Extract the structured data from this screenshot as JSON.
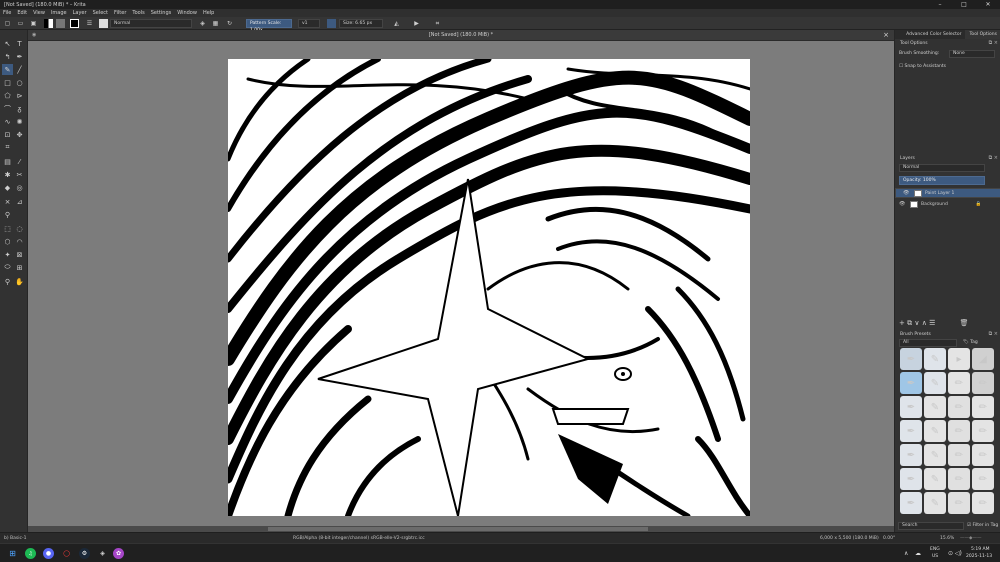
{
  "window": {
    "title": "[Not Saved] (180.0 MiB) * – Krita",
    "controls": [
      "–",
      "□",
      "✕"
    ]
  },
  "menu": [
    "File",
    "Edit",
    "View",
    "Image",
    "Layer",
    "Select",
    "Filter",
    "Tools",
    "Settings",
    "Window",
    "Help"
  ],
  "toolbar": {
    "blend_mode": "Normal",
    "pattern_scale": "Pattern Scale: 1.00x",
    "pattern_angle": "v1",
    "brush_size": "Size: 6.65 px",
    "colors": {
      "foreground": "#000000",
      "background": "#ffffff",
      "accent": "#3d5a80"
    }
  },
  "document": {
    "tab_title": "[Not Saved] (180.0 MiB) *"
  },
  "dock": {
    "tabs": [
      "Advanced Color Selector",
      "Tool Options"
    ],
    "tool_options": {
      "title": "Tool Options",
      "smoothing_label": "Brush Smoothing:",
      "smoothing_value": "None",
      "snap_label": "Snap to Assistants"
    },
    "layers": {
      "title": "Layers",
      "blend_mode": "Normal",
      "opacity": "Opacity: 100%",
      "items": [
        {
          "name": "Paint Layer 1",
          "selected": true
        },
        {
          "name": "Background",
          "selected": false
        }
      ]
    },
    "brush_presets": {
      "title": "Brush Presets",
      "filter": "All",
      "tag_label": "Tag",
      "search_placeholder": "Search",
      "filter_in_tag": "Filter in Tag"
    }
  },
  "status": {
    "brush": "b) Basic-1",
    "color_profile": "RGB/Alpha (8-bit integer/channel)  sRGB-elle-V2-srgbtrc.icc",
    "dimensions": "6,000 x 5,500 (180.0 MiB)",
    "rotation": "0.00°",
    "zoom": "15.6%"
  },
  "taskbar": {
    "lang_top": "ENG",
    "lang_bottom": "US",
    "time": "5:19 AM",
    "date": "2025-11-13"
  }
}
